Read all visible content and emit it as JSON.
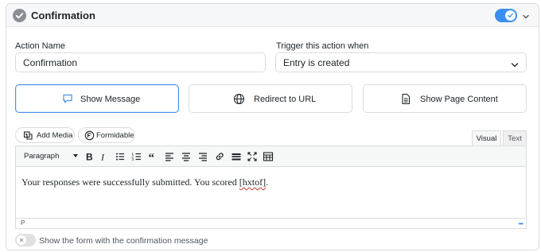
{
  "header": {
    "title": "Confirmation",
    "status_icon": "check-circle-icon",
    "enabled": true
  },
  "action_name": {
    "label": "Action Name",
    "value": "Confirmation"
  },
  "trigger": {
    "label": "Trigger this action when",
    "value": "Entry is created"
  },
  "confirmation_types": [
    {
      "label": "Show Message",
      "icon": "speech-bubble-icon",
      "selected": true
    },
    {
      "label": "Redirect to URL",
      "icon": "globe-icon",
      "selected": false
    },
    {
      "label": "Show Page Content",
      "icon": "document-icon",
      "selected": false
    }
  ],
  "editor": {
    "add_media_label": "Add Media",
    "formidable_label": "Formidable",
    "tab_visual": "Visual",
    "tab_text": "Text",
    "format_select": "Paragraph",
    "content_before": "Your responses were successfully submitted. You scored ",
    "content_shortcode": "[hxtof]",
    "content_after": ".",
    "status_path": "P",
    "toolbar_icons": [
      "bold-icon",
      "italic-icon",
      "bullet-list-icon",
      "numbered-list-icon",
      "blockquote-icon",
      "align-left-icon",
      "align-center-icon",
      "align-right-icon",
      "link-icon",
      "horizontal-line-icon",
      "fullscreen-icon",
      "toolbar-toggle-icon"
    ]
  },
  "show_form_option": {
    "label": "Show the form with the confirmation message",
    "enabled": false
  },
  "colors": {
    "accent": "#3b8ff0",
    "selected_border": "#4a90e2",
    "header_bg": "#f6f7f9"
  }
}
